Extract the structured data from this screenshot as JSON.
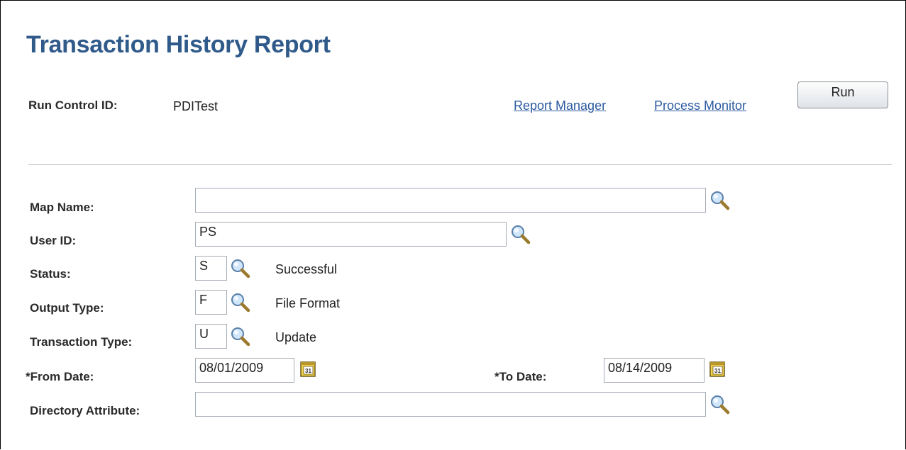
{
  "page": {
    "title": "Transaction History Report"
  },
  "run_control": {
    "label": "Run Control ID:",
    "value": "PDITest",
    "report_manager": "Report Manager",
    "process_monitor": "Process Monitor",
    "run_button": "Run"
  },
  "form": {
    "map_name": {
      "label": "Map Name:",
      "value": ""
    },
    "user_id": {
      "label": "User ID:",
      "value": "PS"
    },
    "status": {
      "label": "Status:",
      "value": "S",
      "description": "Successful"
    },
    "output_type": {
      "label": "Output Type:",
      "value": "F",
      "description": "File Format"
    },
    "transaction_type": {
      "label": "Transaction Type:",
      "value": "U",
      "description": "Update"
    },
    "from_date": {
      "label": "*From Date:",
      "value": "08/01/2009"
    },
    "to_date": {
      "label": "*To Date:",
      "value": "08/14/2009"
    },
    "directory_attribute": {
      "label": "Directory Attribute:",
      "value": ""
    },
    "calendar_day": "31"
  },
  "icons": {
    "lookup": "magnifier-icon",
    "calendar": "calendar-icon"
  },
  "colors": {
    "title": "#2f5a8a",
    "link": "#2c5aa0",
    "calendar": "#f2d24a"
  }
}
